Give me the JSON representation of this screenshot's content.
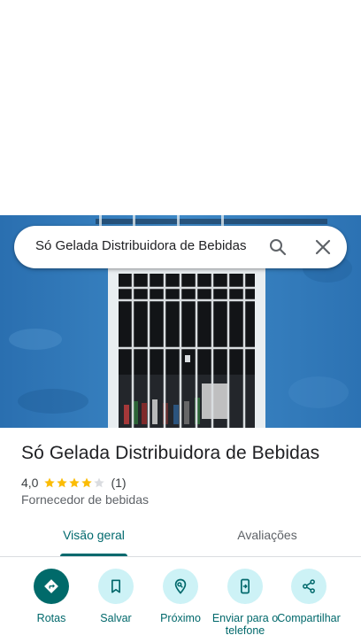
{
  "search": {
    "query": "Só Gelada Distribuidora de Bebidas",
    "search_icon": "search-icon",
    "clear_icon": "close-icon"
  },
  "place": {
    "name": "Só Gelada Distribuidora de Bebidas",
    "rating": "4,0",
    "rating_value": 4,
    "rating_max": 5,
    "review_count": "(1)",
    "category": "Fornecedor de bebidas"
  },
  "tabs": [
    {
      "label": "Visão geral",
      "selected": true
    },
    {
      "label": "Avaliações",
      "selected": false
    }
  ],
  "actions": [
    {
      "label": "Rotas",
      "icon": "directions-icon"
    },
    {
      "label": "Salvar",
      "icon": "bookmark-icon"
    },
    {
      "label": "Próximo",
      "icon": "nearby-icon"
    },
    {
      "label": "Enviar para o telefone",
      "icon": "send-to-phone-icon"
    },
    {
      "label": "Compartilhar",
      "icon": "share-icon"
    }
  ],
  "colors": {
    "accent": "#00696d",
    "action_bg": "#cdf2f6",
    "star": "#fbbc04",
    "star_empty": "#dadce0",
    "photo_wall": "#2f78b8"
  }
}
